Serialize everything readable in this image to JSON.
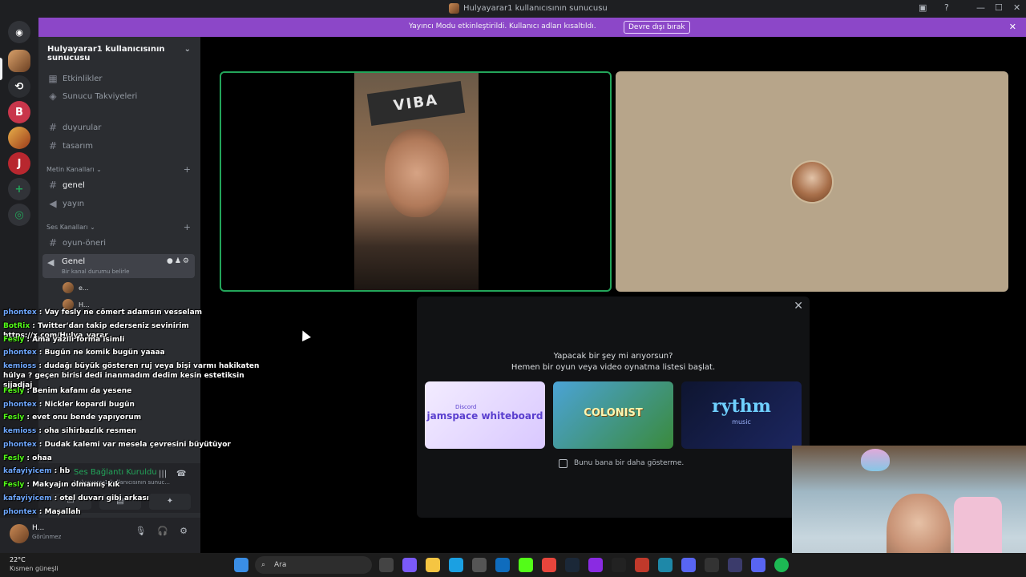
{
  "window": {
    "title": "Hulyayarar1 kullanıcısının sunucusu"
  },
  "banner": {
    "text": "Yayıncı Modu etkinleştirildi. Kullanıcı adları kısaltıldı.",
    "button": "Devre dışı bırak"
  },
  "server": {
    "name": "Hulyayarar1 kullanıcısının sunucusu"
  },
  "channels": {
    "top": [
      {
        "label": "Etkinlikler",
        "icon": "calendar-icon"
      },
      {
        "label": "Sunucu Takviyeleri",
        "icon": "boost-icon"
      }
    ],
    "announcements": [
      {
        "label": "duyurular",
        "icon": "hash-icon"
      },
      {
        "label": "tasarım",
        "icon": "hash-icon"
      }
    ],
    "text_category": "Metin Kanalları",
    "text_channels": [
      {
        "label": "genel",
        "icon": "hash-icon"
      },
      {
        "label": "yayın",
        "icon": "speaker-icon"
      }
    ],
    "voice_category": "Ses Kanalları",
    "voice_channels": [
      {
        "label": "oyun-öneri",
        "icon": "hash-icon"
      }
    ],
    "active_voice": {
      "label": "Genel",
      "status": "Bir kanal durumu belirle"
    },
    "voice_users": [
      "e...",
      "H..."
    ]
  },
  "voice_connection": {
    "status": "Ses Bağlantı Kuruldu",
    "sub": "Hulyayarar1 kullanıcısının sunuc..."
  },
  "user_panel": {
    "name": "H...",
    "status": "Görünmez"
  },
  "activity_modal": {
    "question": "Yapacak bir şey mi arıyorsun?",
    "prompt": "Hemen bir oyun veya video oynatma listesi başlat.",
    "activities": [
      {
        "tag": "Discord",
        "label": "jamspace whiteboard"
      },
      {
        "label": "COLONIST"
      },
      {
        "label": "rythm",
        "sub": "music"
      }
    ],
    "checkbox_label": "Bunu bana bir daha gösterme."
  },
  "stream_video": {
    "sign_text": "VIBA"
  },
  "chat": {
    "messages": [
      {
        "user": "phontex",
        "text": "Vay fesly ne cömert adamsın vesselam",
        "color": "#6fa8ff"
      },
      {
        "user": "BotRix",
        "text": "Twitter'dan takip ederseniz sevinirim https://x.com/Hulya_yarar",
        "color": "#53fc18"
      },
      {
        "user": "Fesly",
        "text": "Ama yazılı forma isimli",
        "color": "#53fc18"
      },
      {
        "user": "phontex",
        "text": "Bugün ne komik bugün yaaaa",
        "color": "#6fa8ff"
      },
      {
        "user": "kemioss",
        "text": "dudağı büyük gösteren ruj veya bişi varmı hakikaten hülya ? geçen birisi dedi inanmadım dedim kesin estetiksin sjjadjaj",
        "color": "#6fa8ff"
      },
      {
        "user": "Fesly",
        "text": "Benim kafamı da yesene",
        "color": "#53fc18"
      },
      {
        "user": "phontex",
        "text": "Nickler kopardi bugün",
        "color": "#6fa8ff"
      },
      {
        "user": "Fesly",
        "text": "evet onu bende yapıyorum",
        "color": "#53fc18"
      },
      {
        "user": "kemioss",
        "text": "oha sihirbazlık resmen",
        "color": "#6fa8ff"
      },
      {
        "user": "phontex",
        "text": "Dudak kalemi var mesela çevresini büyütüyor",
        "color": "#6fa8ff"
      },
      {
        "user": "Fesly",
        "text": "ohaa",
        "color": "#53fc18"
      },
      {
        "user": "kafayiyicem",
        "text": "hb",
        "color": "#6fa8ff"
      },
      {
        "user": "Fesly",
        "text": "Makyajın olmamış kık",
        "color": "#53fc18"
      },
      {
        "user": "kafayiyicem",
        "text": "otel duvarı gibi arkası",
        "color": "#6fa8ff"
      },
      {
        "user": "phontex",
        "text": "Maşallah",
        "color": "#6fa8ff"
      }
    ]
  },
  "taskbar": {
    "temperature": "22°C",
    "weather": "Kısmen güneşli",
    "search_placeholder": "Ara"
  }
}
